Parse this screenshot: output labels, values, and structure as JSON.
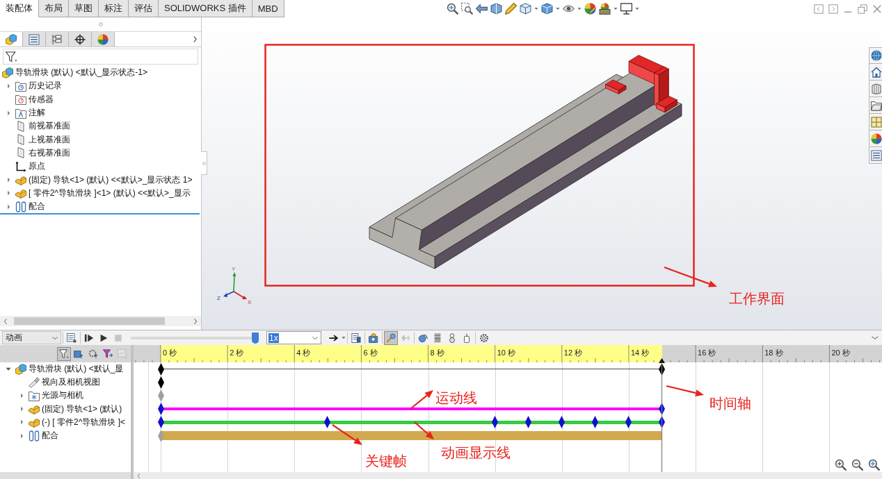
{
  "command_tabs": [
    {
      "label": "装配体",
      "selected": true
    },
    {
      "label": "布局",
      "selected": false
    },
    {
      "label": "草图",
      "selected": false
    },
    {
      "label": "标注",
      "selected": false
    },
    {
      "label": "评估",
      "selected": false
    },
    {
      "label": "SOLIDWORKS 插件",
      "selected": false
    },
    {
      "label": "MBD",
      "selected": false
    }
  ],
  "feature_manager": {
    "tabs": [
      {
        "selected": true
      },
      {
        "selected": false
      },
      {
        "selected": false
      },
      {
        "selected": false
      },
      {
        "selected": false
      }
    ],
    "tree": [
      {
        "label": "导轨滑块 (默认) <默认_显示状态-1>",
        "kind": "assembly",
        "children": [
          {
            "label": "历史记录",
            "kind": "history",
            "expanded": false
          },
          {
            "label": "传感器",
            "kind": "sensors"
          },
          {
            "label": "注解",
            "kind": "annotations",
            "expanded": false
          },
          {
            "label": "前视基准面",
            "kind": "plane"
          },
          {
            "label": "上视基准面",
            "kind": "plane"
          },
          {
            "label": "右视基准面",
            "kind": "plane"
          },
          {
            "label": "原点",
            "kind": "origin"
          },
          {
            "label": "(固定) 导轨<1> (默认) <<默认>_显示状态 1>",
            "kind": "component",
            "expanded": false
          },
          {
            "label": "[ 零件2^导轨滑块 ]<1> (默认) <<默认>_显示",
            "kind": "component",
            "expanded": false
          },
          {
            "label": "配合",
            "kind": "mates",
            "expanded": false
          }
        ]
      }
    ]
  },
  "graphics": {
    "triad": [
      "Y",
      "Z",
      "X"
    ],
    "callout": "工作界面"
  },
  "motion_manager": {
    "study": "动画",
    "play_controls": [
      {
        "disabled": false
      },
      {
        "disabled": false
      },
      {
        "disabled": false
      },
      {
        "disabled": true
      }
    ],
    "playback": {
      "level": 1
    },
    "speed": "1x",
    "tools": [
      {
        "pressed": false,
        "disabled": false
      },
      {
        "pressed": false,
        "disabled": false
      },
      {
        "pressed": false,
        "disabled": false
      },
      {
        "pressed": true,
        "disabled": false
      },
      {
        "pressed": false,
        "disabled": true
      },
      {
        "pressed": false,
        "disabled": false
      },
      {
        "pressed": false,
        "disabled": false
      },
      {
        "pressed": false,
        "disabled": false
      },
      {
        "pressed": false,
        "disabled": false
      },
      {
        "pressed": false,
        "disabled": false
      }
    ],
    "filters": [
      {
        "pressed": true,
        "disabled": false
      },
      {
        "pressed": false,
        "disabled": false
      },
      {
        "pressed": false,
        "disabled": false
      },
      {
        "pressed": false,
        "disabled": false
      },
      {
        "pressed": false,
        "disabled": true
      }
    ],
    "tree": [
      {
        "label": "导轨滑块 (默认) <默认_显",
        "kind": "assembly",
        "expanded": true,
        "track": {
          "kind": "rule",
          "color": "#4a4a4a"
        },
        "keyframes": [
          {
            "level": 0,
            "color": "#000000"
          },
          {
            "level": 1,
            "color": "#000000"
          }
        ],
        "children": [
          {
            "label": "视向及相机视图",
            "kind": "camera",
            "keyframes": [
              {
                "level": 0,
                "color": "#000000"
              }
            ]
          },
          {
            "label": "光源与相机",
            "kind": "lights",
            "expanded": false,
            "keyframes": [
              {
                "level": 0,
                "color": "#a0a0a0"
              }
            ]
          },
          {
            "label": "(固定) 导轨<1> (默认)",
            "kind": "component",
            "expanded": false,
            "track": {
              "kind": "stripe",
              "color": "#ff00ff"
            },
            "keyframes": [
              {
                "level": 0,
                "color": "#1010d0"
              },
              {
                "level": 1,
                "color": "#1010d0"
              }
            ]
          },
          {
            "label": "(-) [ 零件2^导轨滑块 ]<",
            "kind": "component",
            "expanded": false,
            "track": {
              "kind": "stripe",
              "color": "#33cc44"
            },
            "keyframes": [
              {
                "level": 0,
                "color": "#1010d0"
              },
              {
                "level": 0.333,
                "color": "#1010d0"
              },
              {
                "level": 0.667,
                "color": "#1010d0"
              },
              {
                "level": 0.733,
                "color": "#1010d0"
              },
              {
                "level": 0.8,
                "color": "#1010d0"
              },
              {
                "level": 0.867,
                "color": "#1010d0"
              },
              {
                "level": 0.933,
                "color": "#1010d0"
              },
              {
                "level": 1,
                "color": "#1010d0"
              }
            ]
          },
          {
            "label": "配合",
            "kind": "mates",
            "expanded": false,
            "track": {
              "kind": "band",
              "color": "#d2a94e"
            },
            "keyframes": [
              {
                "level": 0,
                "color": "#a0a0a0"
              }
            ]
          }
        ]
      }
    ],
    "timeline": {
      "ruler": [
        "0 秒",
        "2 秒",
        "4 秒",
        "6 秒",
        "8 秒",
        "10 秒",
        "12 秒",
        "14 秒",
        "16 秒",
        "18 秒",
        "20 秒"
      ],
      "duration": {
        "level": 0.695
      }
    },
    "callouts": [
      "运动线",
      "时间轴",
      "关键帧",
      "动画显示线"
    ]
  }
}
